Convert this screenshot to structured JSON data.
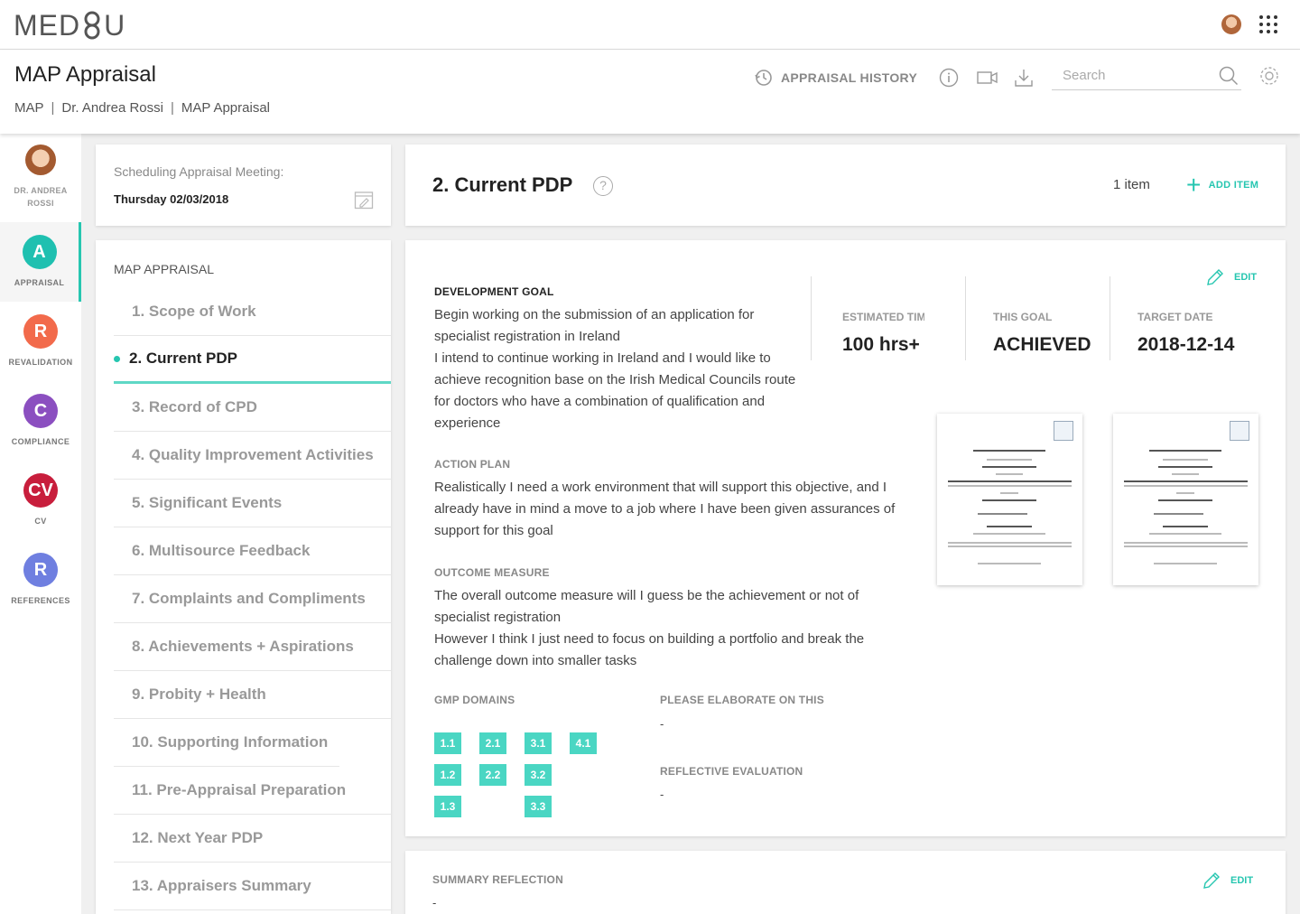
{
  "app": {
    "logo_left": "MED",
    "logo_right": "U"
  },
  "header": {
    "title": "MAP Appraisal",
    "breadcrumb": [
      "MAP",
      "Dr. Andrea Rossi",
      "MAP Appraisal"
    ],
    "history_label": "APPRAISAL HISTORY",
    "search_placeholder": "Search"
  },
  "rail": {
    "user_name_line1": "DR. ANDREA",
    "user_name_line2": "ROSSI",
    "items": [
      {
        "letter": "A",
        "label": "APPRAISAL",
        "color": "#1fc0b0"
      },
      {
        "letter": "R",
        "label": "REVALIDATION",
        "color": "#f26a4b"
      },
      {
        "letter": "C",
        "label": "COMPLIANCE",
        "color": "#8b4fc0"
      },
      {
        "letter": "CV",
        "label": "CV",
        "color": "#c81e3c"
      },
      {
        "letter": "R",
        "label": "REFERENCES",
        "color": "#6f7fe0"
      }
    ]
  },
  "schedule": {
    "label": "Scheduling Appraisal Meeting:",
    "date": "Thursday 02/03/2018"
  },
  "nav": {
    "title": "MAP APPRAISAL",
    "items": [
      "1. Scope of Work",
      "2. Current PDP",
      "3. Record of CPD",
      "4. Quality Improvement Activities",
      "5. Significant Events",
      "6. Multisource Feedback",
      "7. Complaints and Compliments",
      "8. Achievements + Aspirations",
      "9. Probity + Health",
      "10. Supporting Information",
      "11. Pre-Appraisal Preparation",
      "12. Next Year PDP",
      "13. Appraisers Summary"
    ]
  },
  "section": {
    "title": "2. Current PDP",
    "help": "?",
    "count": "1 item",
    "add_label": "ADD ITEM"
  },
  "goal": {
    "edit_label": "EDIT",
    "dev_goal_heading": "DEVELOPMENT GOAL",
    "dev_goal_lines": [
      "Begin working on the submission of an application for",
      "specialist registration in Ireland",
      "I intend to continue working in Ireland and I would like to",
      "achieve recognition base on the Irish Medical Councils route",
      "for doctors who have a combination of qualification and",
      "experience"
    ],
    "action_heading": "ACTION PLAN",
    "action_lines": [
      "Realistically I need a work environment that will support this objective, and I",
      "already have in mind a move to a job where I have been given assurances of",
      "support for this goal"
    ],
    "outcome_heading": "OUTCOME MEASURE",
    "outcome_lines": [
      "The overall outcome measure will I guess be the achievement or not of",
      "specialist registration",
      "However I think I just need to focus on building a portfolio and break the",
      "challenge down into smaller tasks"
    ],
    "stats": [
      {
        "label": "ESTIMATED TIME",
        "value": "100 hrs+"
      },
      {
        "label": "THIS GOAL",
        "value": "ACHIEVED"
      },
      {
        "label": "TARGET DATE",
        "value": "2018-12-14"
      }
    ],
    "gmp_heading": "GMP DOMAINS",
    "gmp_domains": [
      "1.1",
      "2.1",
      "3.1",
      "4.1",
      "1.2",
      "2.2",
      "3.2",
      "1.3",
      "3.3"
    ],
    "elaborate_heading": "PLEASE ELABORATE ON THIS",
    "elaborate_value": "-",
    "reflective_heading": "REFLECTIVE EVALUATION",
    "reflective_value": "-"
  },
  "summary": {
    "heading": "SUMMARY REFLECTION",
    "value": "-",
    "edit_label": "EDIT"
  },
  "colors": {
    "accent": "#26c6b0",
    "tag": "#4ad6c3"
  }
}
